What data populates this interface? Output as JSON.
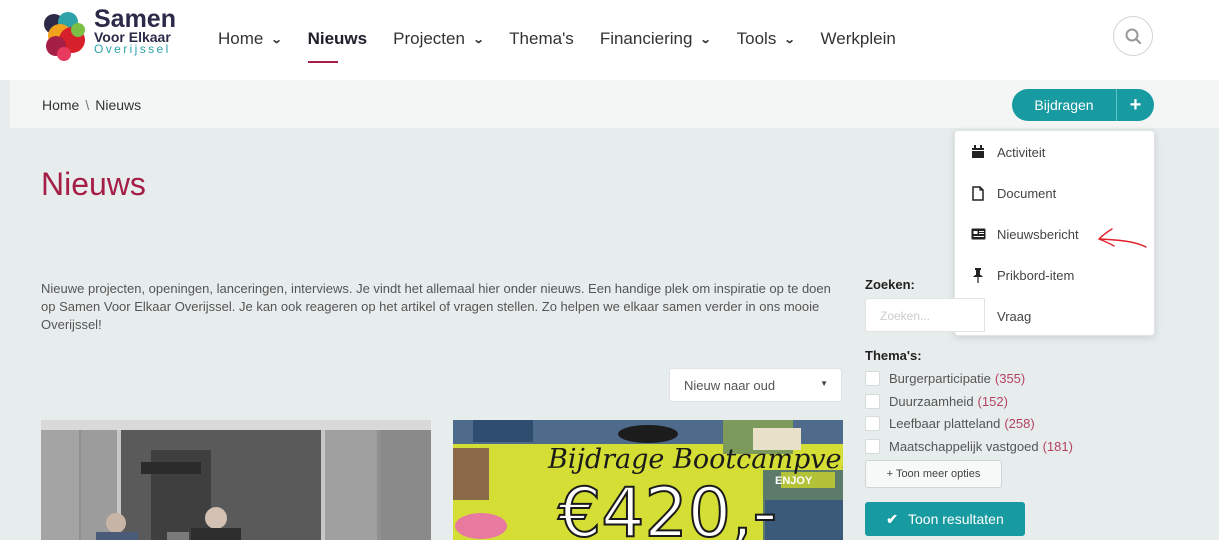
{
  "header": {
    "logo": {
      "line1": "Samen",
      "line2": "Voor Elkaar",
      "line3": "Overijssel"
    },
    "nav": [
      {
        "label": "Home",
        "dropdown": true,
        "active": false
      },
      {
        "label": "Nieuws",
        "dropdown": false,
        "active": true
      },
      {
        "label": "Projecten",
        "dropdown": true,
        "active": false
      },
      {
        "label": "Thema's",
        "dropdown": false,
        "active": false
      },
      {
        "label": "Financiering",
        "dropdown": true,
        "active": false
      },
      {
        "label": "Tools",
        "dropdown": true,
        "active": false
      },
      {
        "label": "Werkplein",
        "dropdown": false,
        "active": false
      }
    ],
    "search_icon": "search-icon"
  },
  "breadcrumb": {
    "home": "Home",
    "separator": "\\",
    "current": "Nieuws"
  },
  "contribute": {
    "label": "Bijdragen",
    "plus": "+"
  },
  "dropdown": {
    "items": [
      {
        "label": "Activiteit",
        "icon": "calendar-icon"
      },
      {
        "label": "Document",
        "icon": "document-icon"
      },
      {
        "label": "Nieuwsbericht",
        "icon": "newspaper-icon"
      },
      {
        "label": "Prikbord-item",
        "icon": "pin-icon"
      },
      {
        "label": "Vraag",
        "icon": "question-icon"
      }
    ]
  },
  "main": {
    "title": "Nieuws",
    "intro": "Nieuwe projecten, openingen, lanceringen, interviews. Je vindt het allemaal hier onder nieuws. Een handige plek om inspiratie op te doen op Samen Voor Elkaar Overijssel. Je kan ook reageren op het artikel of vragen stellen. Zo helpen we elkaar samen verder in ons mooie Overijssel!",
    "sort": {
      "selected": "Nieuw naar oud"
    },
    "cards": [
      {
        "image": "photo-two-men"
      },
      {
        "image_text_1": "Bijdrage Bootcampveld",
        "image_text_2": "€420,-",
        "image_text_3": "ENJOY"
      }
    ]
  },
  "sidebar": {
    "search_label": "Zoeken:",
    "search_placeholder": "Zoeken...",
    "themes_label": "Thema's:",
    "themes": [
      {
        "label": "Burgerparticipatie",
        "count": "(355)"
      },
      {
        "label": "Duurzaamheid",
        "count": "(152)"
      },
      {
        "label": "Leefbaar platteland",
        "count": "(258)"
      },
      {
        "label": "Maatschappelijk vastgoed",
        "count": "(181)"
      }
    ],
    "more_options": "+ Toon meer opties",
    "results_button": "Toon resultaten"
  },
  "colors": {
    "accent_teal": "#179aa0",
    "brand_red": "#a51e46",
    "annotation_arrow": "#e0202a"
  }
}
